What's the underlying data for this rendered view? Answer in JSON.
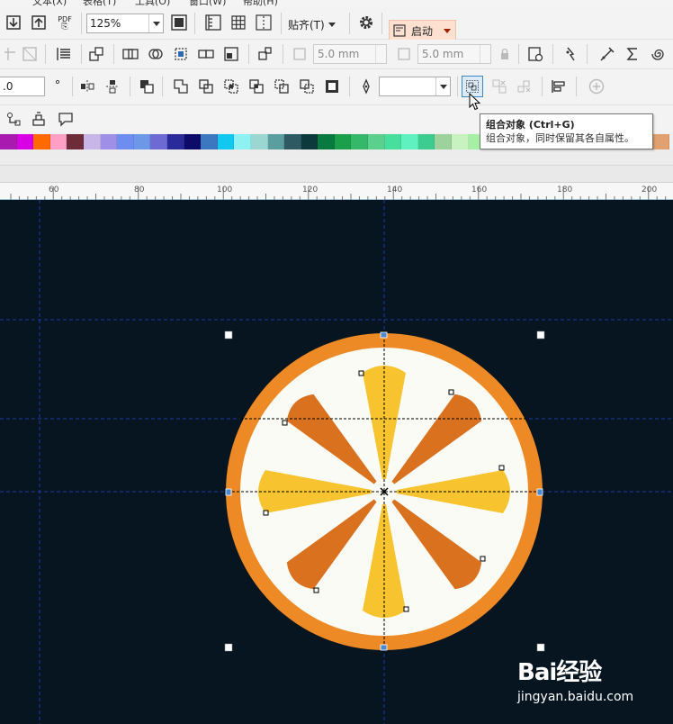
{
  "menubar": {
    "items": [
      "文本(X)",
      "表格(T)",
      "工具(O)",
      "窗口(W)",
      "帮助(H)"
    ]
  },
  "toolbar1": {
    "pdf_label": "PDF",
    "zoom_value": "125%",
    "snap_label": "贴齐(T)",
    "launch_label": "启动"
  },
  "toolbar2": {
    "width_value": "5.0 mm",
    "height_value": "5.0 mm"
  },
  "toolbar3": {
    "outline_value": ".0",
    "outline_unit_icon": "degree-icon"
  },
  "tooltip": {
    "title": "组合对象 (Ctrl+G)",
    "description": "组合对象，同时保留其各自属性。"
  },
  "palette": {
    "colors": [
      "#a81ab0",
      "#d900e6",
      "#ff6a00",
      "#ff9fc6",
      "#6d2c37",
      "#c8b6e8",
      "#a08fe6",
      "#6e8df0",
      "#6d98e8",
      "#6e6ad4",
      "#2b2a9a",
      "#0e0a6a",
      "#3c78c0",
      "#12c8f0",
      "#8ef2f2",
      "#9cd6d0",
      "#5a9ea0",
      "#2e5a64",
      "#0c3a3c",
      "#087a40",
      "#1aa04a",
      "#35b86a",
      "#5bd08e",
      "#48de9e",
      "#5ff2c0",
      "#3ccc90",
      "#9ed29c",
      "#c8f2c0",
      "#a6f0a6",
      "#6ea86c",
      "#3e8c3a",
      "#9ccc3a",
      "#d0e850",
      "#e6e87e",
      "#b8b060",
      "#8a8040",
      "#6c4a28",
      "#a86a38",
      "#c88a50",
      "#e0a070"
    ]
  },
  "ruler": {
    "labels": [
      "60",
      "80",
      "100",
      "120",
      "140",
      "160",
      "180",
      "200"
    ]
  },
  "canvas": {
    "background": "#061520",
    "rim_color": "#ee8a25",
    "flesh_color": "#fbfbf6",
    "segment_yellow": "#f7c42f",
    "segment_orange": "#d9711f"
  },
  "watermark": {
    "brand": "Bai经验",
    "url": "jingyan.baidu.com"
  }
}
